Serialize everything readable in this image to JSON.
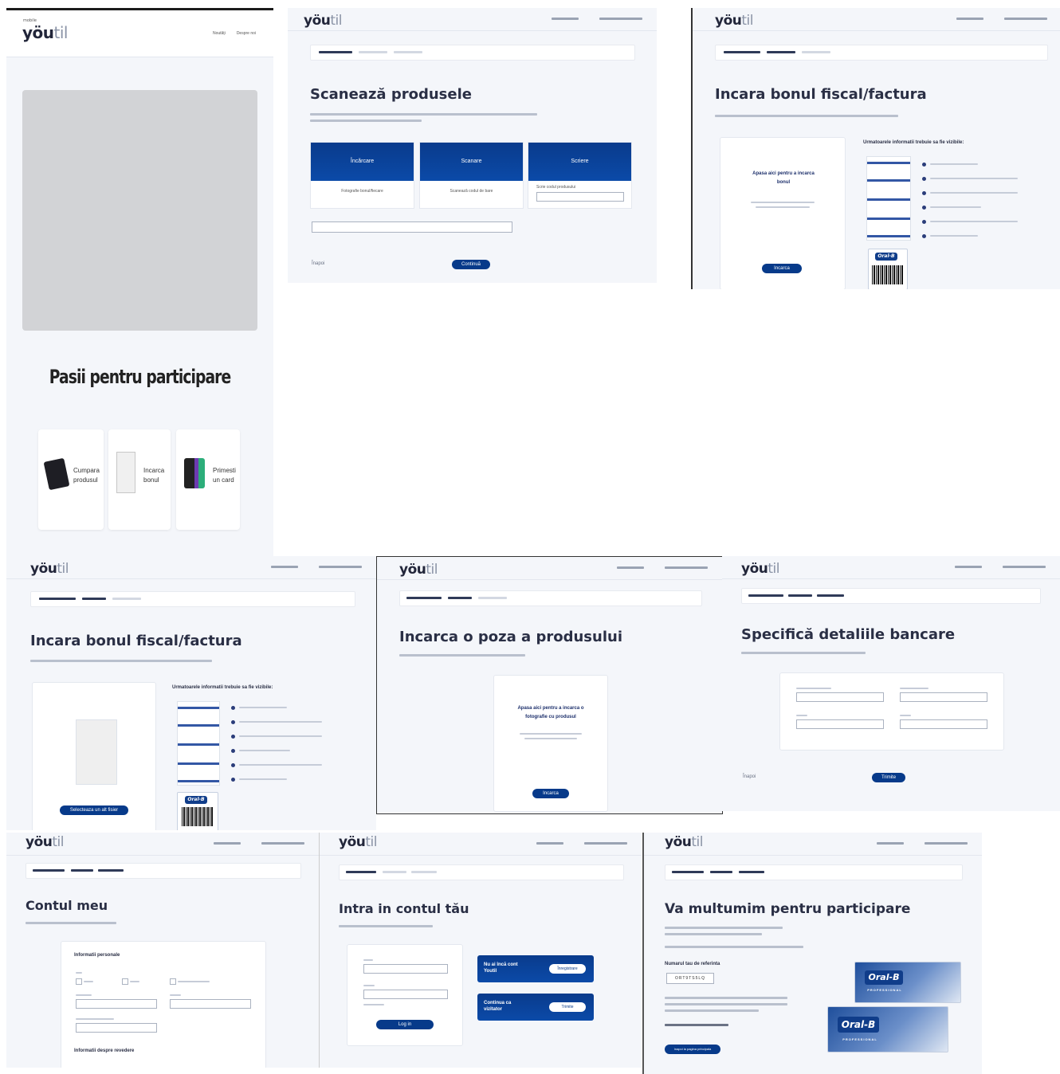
{
  "brand": {
    "logo_main": "yöu",
    "logo_sub": "til",
    "logo_mini": "mobile"
  },
  "screen1": {
    "nav": [
      "Noutăți",
      "Despre noi"
    ],
    "title": "Pasii pentru participare",
    "steps": [
      {
        "label": "Cumpara produsul",
        "icon": "shopping-bag-icon"
      },
      {
        "label": "Incarca bonul",
        "icon": "receipt-icon"
      },
      {
        "label": "Primesti un card",
        "icon": "gift-card-icon"
      }
    ]
  },
  "screen2": {
    "title": "Scanează produsele",
    "options": [
      {
        "label": "Încărcare",
        "hint": "Fotografie bonul/fiecare"
      },
      {
        "label": "Scanare",
        "hint": "Scanează codul de bare"
      },
      {
        "label": "Scriere",
        "hint": "Scrie codul produsului"
      }
    ],
    "back": "Înapoi",
    "next": "Continuă"
  },
  "screen3": {
    "title": "Incara bonul fiscal/factura",
    "upload_text": "Apasa aici pentru a incarca bonul",
    "upload_btn": "Incarca",
    "info_title": "Urmatoarele informatii trebuie sa fie vizibile:",
    "product_brand": "Oral-B"
  },
  "screen4": {
    "title": "Incara bonul fiscal/factura",
    "info_title": "Urmatoarele informatii trebuie sa fie vizibile:",
    "upload_btn": "Selecteaza un alt fisier",
    "product_brand": "Oral-B"
  },
  "screen5": {
    "title": "Incarca o poza a produsului",
    "upload_text": "Apasa aici pentru a incarca o fotografie cu produsul",
    "upload_btn": "Incarca"
  },
  "screen6": {
    "title": "Specifică detaliile bancare",
    "back": "Înapoi",
    "next": "Trimite"
  },
  "screen7": {
    "title": "Contul meu",
    "section1": "Informatii personale",
    "section2": "Informatii despre revedere"
  },
  "screen8": {
    "title": "Intra in contul tău",
    "login_btn": "Log in",
    "card1_text": "Nu ai încă cont Youtil",
    "card1_btn": "Înregistrare",
    "card2_text": "Continua ca vizitator",
    "card2_btn": "Trimite"
  },
  "screen9": {
    "title": "Va multumim pentru participare",
    "ref_label": "Numarul tau de referinta",
    "ref_code": "ORT9TS5LQ",
    "cta": "Inapoi la pagina principala",
    "product_brand": "Oral-B",
    "product_sub": "PROFESSIONAL"
  }
}
